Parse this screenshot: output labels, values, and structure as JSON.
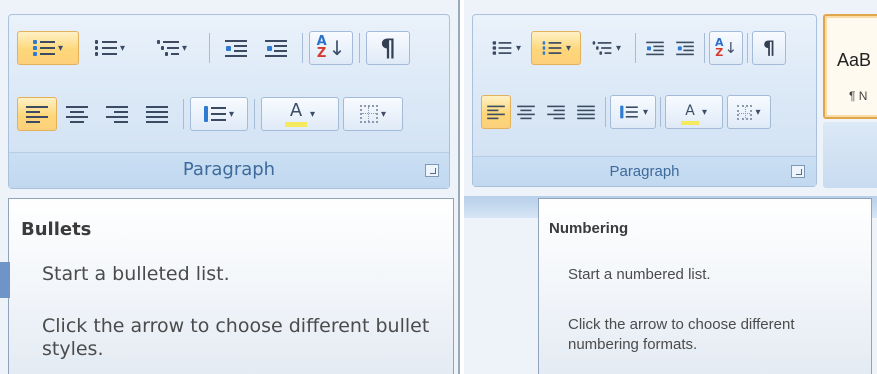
{
  "left_panel": {
    "group_title": "Paragraph",
    "tooltip": {
      "title": "Bullets",
      "description": "Start a bulleted list.",
      "hint": "Click the arrow to choose different bullet styles."
    }
  },
  "right_panel": {
    "group_title": "Paragraph",
    "style_gallery": {
      "style_sample": "AaB",
      "style_mark": "¶ N"
    },
    "tooltip": {
      "title": "Numbering",
      "description": "Start a numbered list.",
      "hint": "Click the arrow to choose different numbering formats."
    }
  },
  "glyphs": {
    "dropdown_caret": "▾",
    "pilcrow": "¶",
    "sort_a": "A",
    "sort_z": "Z",
    "sort_arrow": "↓",
    "font_color_letter": "A"
  },
  "colors": {
    "ribbon_blue": "#dbe8f6",
    "active_highlight": "#fed77a",
    "group_title_text": "#3e6a9c"
  }
}
